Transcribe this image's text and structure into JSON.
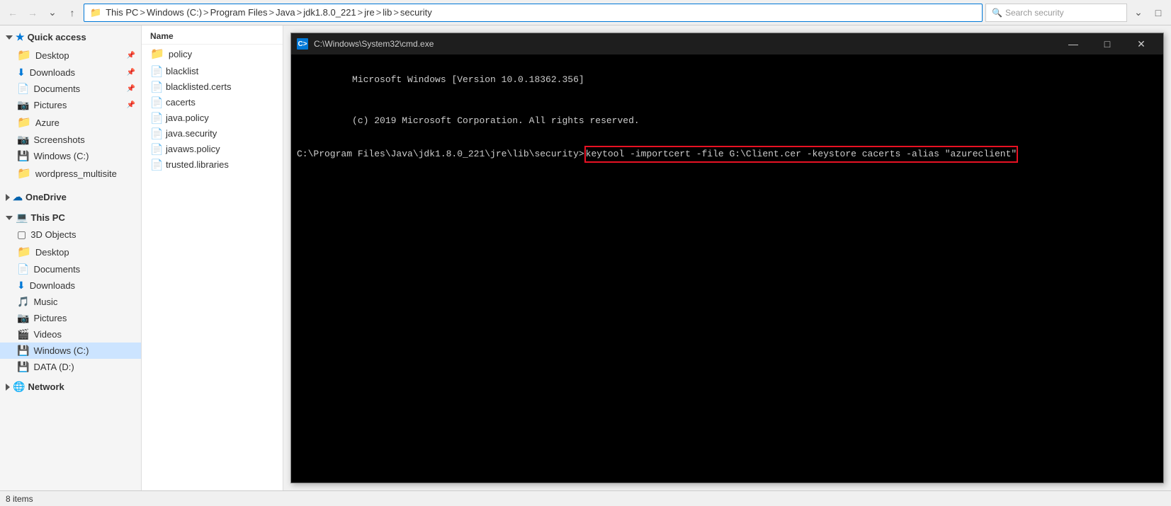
{
  "toolbar": {
    "back_btn": "←",
    "forward_btn": "→",
    "down_btn": "⌄",
    "up_btn": "↑",
    "address": {
      "parts": [
        "This PC",
        "Windows (C:)",
        "Program Files",
        "Java",
        "jdk1.8.0_221",
        "jre",
        "lib",
        "security"
      ]
    },
    "search_placeholder": "Search security"
  },
  "sidebar": {
    "quick_access_label": "Quick access",
    "items_quick": [
      {
        "label": "Desktop",
        "icon": "folder",
        "pinned": true
      },
      {
        "label": "Downloads",
        "icon": "download",
        "pinned": true
      },
      {
        "label": "Documents",
        "icon": "doc",
        "pinned": true
      },
      {
        "label": "Pictures",
        "icon": "doc",
        "pinned": true
      },
      {
        "label": "Azure",
        "icon": "folder"
      },
      {
        "label": "Screenshots",
        "icon": "doc"
      },
      {
        "label": "Windows (C:)",
        "icon": "drive"
      },
      {
        "label": "wordpress_multisite",
        "icon": "folder"
      }
    ],
    "onedrive_label": "OneDrive",
    "this_pc_label": "This PC",
    "items_pc": [
      {
        "label": "3D Objects",
        "icon": "3d"
      },
      {
        "label": "Desktop",
        "icon": "folder-blue"
      },
      {
        "label": "Documents",
        "icon": "doc"
      },
      {
        "label": "Downloads",
        "icon": "download"
      },
      {
        "label": "Music",
        "icon": "music"
      },
      {
        "label": "Pictures",
        "icon": "doc"
      },
      {
        "label": "Videos",
        "icon": "video"
      },
      {
        "label": "Windows (C:)",
        "icon": "drive",
        "selected": true
      },
      {
        "label": "DATA (D:)",
        "icon": "drive"
      }
    ],
    "network_label": "Network"
  },
  "file_list": {
    "header": "Name",
    "items": [
      {
        "label": "policy",
        "type": "folder"
      },
      {
        "label": "blacklist",
        "type": "file"
      },
      {
        "label": "blacklisted.certs",
        "type": "file"
      },
      {
        "label": "cacerts",
        "type": "file"
      },
      {
        "label": "java.policy",
        "type": "file"
      },
      {
        "label": "java.security",
        "type": "file"
      },
      {
        "label": "javaws.policy",
        "type": "file"
      },
      {
        "label": "trusted.libraries",
        "type": "file"
      }
    ]
  },
  "cmd_window": {
    "titlebar": "C:\\Windows\\System32\\cmd.exe",
    "icon_label": "C>",
    "line1": "Microsoft Windows [Version 10.0.18362.356]",
    "line2": "(c) 2019 Microsoft Corporation. All rights reserved.",
    "prompt": "C:\\Program Files\\Java\\jdk1.8.0_221\\jre\\lib\\security>",
    "command": "keytool -importcert -file G:\\Client.cer -keystore cacerts -alias \"azureclient\"",
    "controls": {
      "minimize": "—",
      "maximize": "□",
      "close": "✕"
    }
  },
  "status_bar": {
    "items_count": "8 items"
  }
}
